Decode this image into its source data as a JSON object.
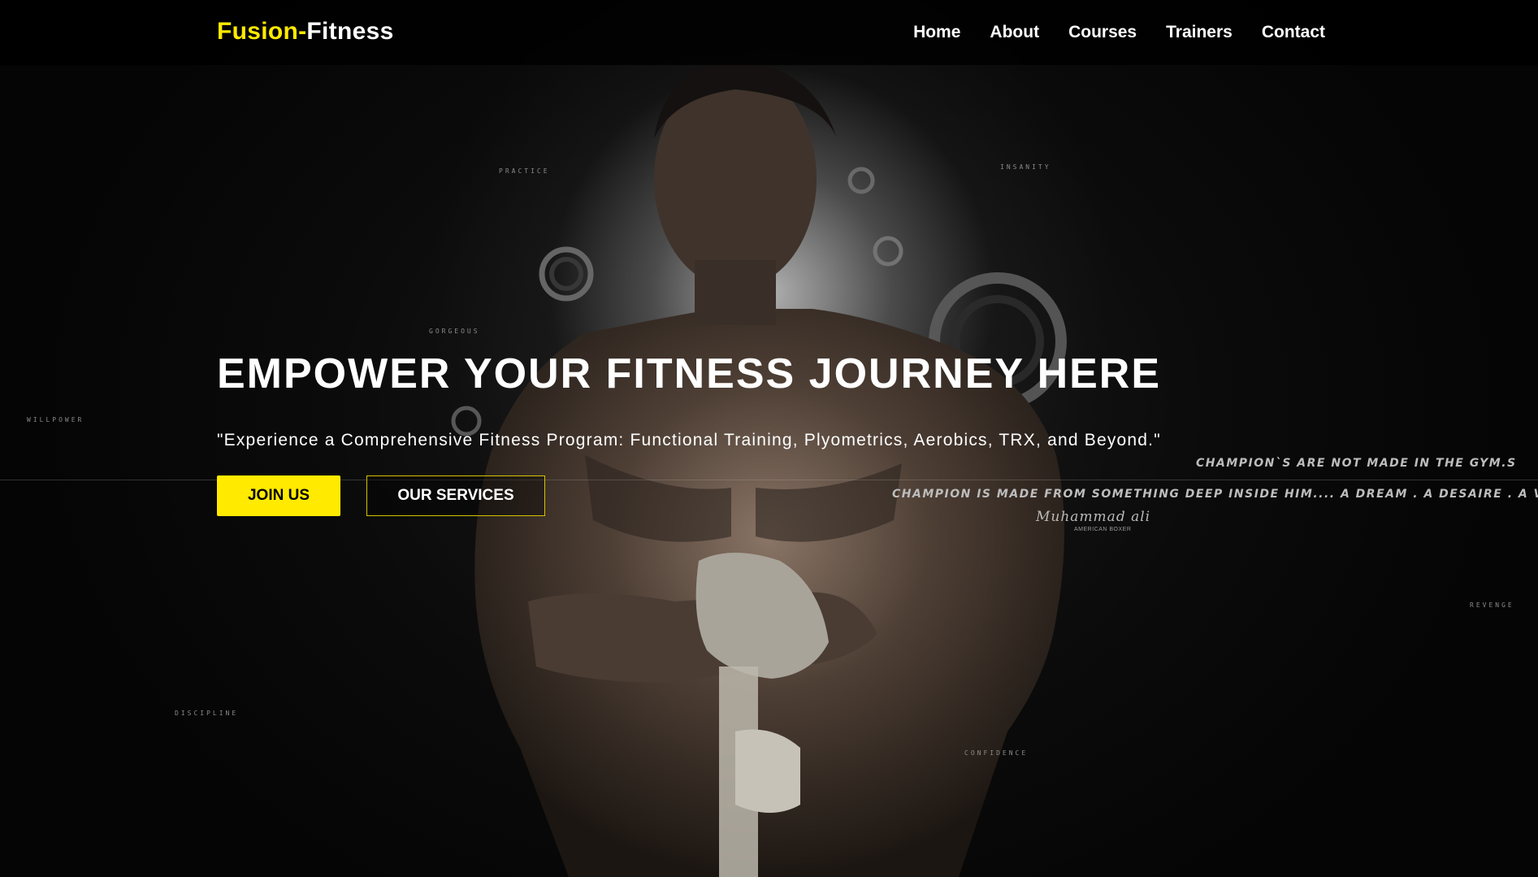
{
  "brand": {
    "part1": "Fusion-",
    "part2": "Fitness",
    "accent_color": "#ffea00"
  },
  "nav": {
    "items": [
      {
        "label": "Home"
      },
      {
        "label": "About"
      },
      {
        "label": "Courses"
      },
      {
        "label": "Trainers"
      },
      {
        "label": "Contact"
      }
    ]
  },
  "hero": {
    "title": "EMPOWER YOUR FITNESS JOURNEY HERE",
    "subtitle": "\"Experience a Comprehensive Fitness Program: Functional Training, Plyometrics, Aerobics, TRX, and Beyond.\"",
    "join_label": "JOIN US",
    "services_label": "OUR SERVICES"
  },
  "background_art": {
    "quote_line1": "CHAMPION`S ARE NOT MADE IN THE GYM.S",
    "quote_line2": "CHAMPION IS MADE FROM SOMETHING DEEP INSIDE HIM.... A DREAM . A DESAIRE . A VISION...!",
    "signature": "Muhammad ali",
    "signature_sub": "AMERICAN BOXER",
    "words": [
      "PRACTICE",
      "INSANITY",
      "GORGEOUS",
      "WILLPOWER",
      "DISCIPLINE",
      "CONFIDENCE",
      "REVENGE"
    ]
  }
}
